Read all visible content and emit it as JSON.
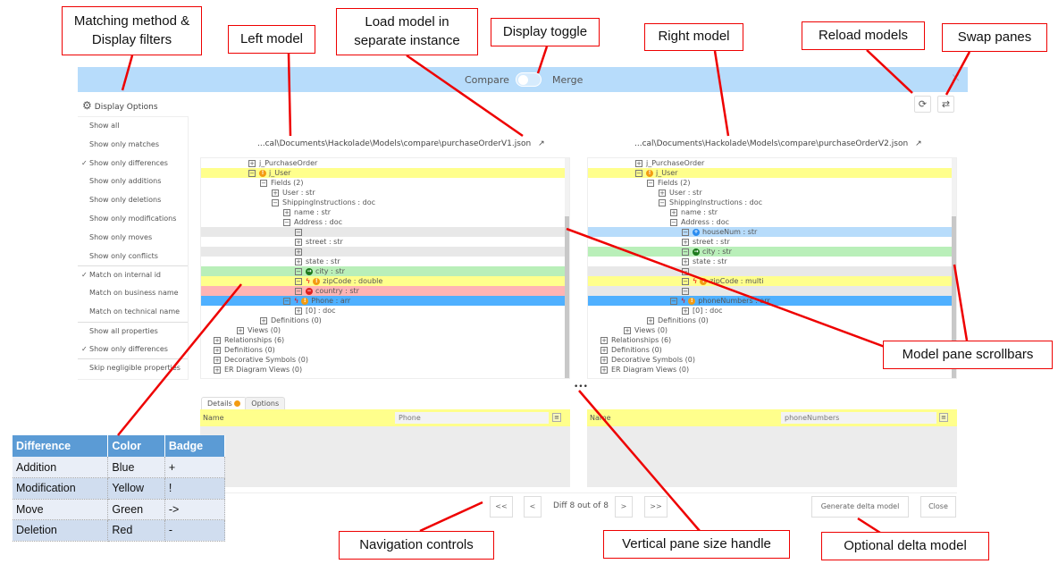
{
  "header": {
    "compare_label": "Compare",
    "merge_label": "Merge",
    "mode": "compare",
    "close_icon": "×"
  },
  "toolbar": {
    "reload_icon": "⟳",
    "swap_icon": "⇄"
  },
  "display_options": {
    "title": "Display Options",
    "items": [
      {
        "label": "Show all",
        "checked": false
      },
      {
        "label": "Show only matches",
        "checked": false
      },
      {
        "label": "Show only differences",
        "checked": true
      },
      {
        "label": "Show only additions",
        "checked": false
      },
      {
        "label": "Show only deletions",
        "checked": false
      },
      {
        "label": "Show only modifications",
        "checked": false
      },
      {
        "label": "Show only moves",
        "checked": false
      },
      {
        "label": "Show only conflicts",
        "checked": false
      },
      {
        "label": "Match on internal id",
        "checked": true,
        "sep": true
      },
      {
        "label": "Match on business name",
        "checked": false
      },
      {
        "label": "Match on technical name",
        "checked": false
      },
      {
        "label": "Show all properties",
        "checked": false,
        "sep": true
      },
      {
        "label": "Show only differences",
        "checked": true
      },
      {
        "label": "Skip negligible properties",
        "checked": false,
        "sep": true
      }
    ]
  },
  "left_model": {
    "path": "...cal\\Documents\\Hackolade\\Models\\compare\\purchaseOrderV1.json",
    "rows": [
      {
        "label": "j_PurchaseOrder",
        "level": 3,
        "box": "+",
        "state": ""
      },
      {
        "label": "j_User",
        "level": 3,
        "box": "-",
        "state": "mod",
        "badges": [
          "mod"
        ]
      },
      {
        "label": "Fields (2)",
        "level": 4,
        "box": "-",
        "state": ""
      },
      {
        "label": "User : str",
        "level": 5,
        "box": "+",
        "state": ""
      },
      {
        "label": "ShippingInstructions : doc",
        "level": 5,
        "box": "-",
        "state": ""
      },
      {
        "label": "name : str",
        "level": 6,
        "box": "+",
        "state": ""
      },
      {
        "label": "Address : doc",
        "level": 6,
        "box": "-",
        "state": ""
      },
      {
        "label": "",
        "level": 7,
        "box": "-",
        "state": "blank"
      },
      {
        "label": "street : str",
        "level": 7,
        "box": "+",
        "state": ""
      },
      {
        "label": "",
        "level": 7,
        "box": "+",
        "state": "blank"
      },
      {
        "label": "state : str",
        "level": 7,
        "box": "+",
        "state": ""
      },
      {
        "label": "city : str",
        "level": 7,
        "box": "-",
        "state": "move",
        "badges": [
          "move"
        ]
      },
      {
        "label": "zipCode : double",
        "level": 7,
        "box": "-",
        "state": "mod",
        "badges": [
          "conflict",
          "mod"
        ]
      },
      {
        "label": "country : str",
        "level": 7,
        "box": "-",
        "state": "del",
        "badges": [
          "del"
        ]
      },
      {
        "label": "Phone : arr",
        "level": 6,
        "box": "-",
        "state": "sel",
        "badges": [
          "conflict",
          "mod"
        ]
      },
      {
        "label": "[0] : doc",
        "level": 7,
        "box": "+",
        "state": ""
      },
      {
        "label": "Definitions (0)",
        "level": 4,
        "box": "+",
        "state": ""
      },
      {
        "label": "Views (0)",
        "level": 2,
        "box": "+",
        "state": ""
      },
      {
        "label": "Relationships (6)",
        "level": 0,
        "box": "+",
        "state": ""
      },
      {
        "label": "Definitions (0)",
        "level": 0,
        "box": "+",
        "state": ""
      },
      {
        "label": "Decorative Symbols (0)",
        "level": 0,
        "box": "+",
        "state": ""
      },
      {
        "label": "ER Diagram Views (0)",
        "level": 0,
        "box": "+",
        "state": ""
      }
    ]
  },
  "right_model": {
    "path": "...cal\\Documents\\Hackolade\\Models\\compare\\purchaseOrderV2.json",
    "rows": [
      {
        "label": "j_PurchaseOrder",
        "level": 3,
        "box": "+",
        "state": ""
      },
      {
        "label": "j_User",
        "level": 3,
        "box": "-",
        "state": "mod",
        "badges": [
          "mod"
        ]
      },
      {
        "label": "Fields (2)",
        "level": 4,
        "box": "-",
        "state": ""
      },
      {
        "label": "User : str",
        "level": 5,
        "box": "+",
        "state": ""
      },
      {
        "label": "ShippingInstructions : doc",
        "level": 5,
        "box": "-",
        "state": ""
      },
      {
        "label": "name : str",
        "level": 6,
        "box": "+",
        "state": ""
      },
      {
        "label": "Address : doc",
        "level": 6,
        "box": "-",
        "state": ""
      },
      {
        "label": "houseNum : str",
        "level": 7,
        "box": "-",
        "state": "add",
        "badges": [
          "add"
        ]
      },
      {
        "label": "street : str",
        "level": 7,
        "box": "+",
        "state": ""
      },
      {
        "label": "city : str",
        "level": 7,
        "box": "-",
        "state": "move",
        "badges": [
          "move"
        ]
      },
      {
        "label": "state : str",
        "level": 7,
        "box": "+",
        "state": ""
      },
      {
        "label": "",
        "level": 7,
        "box": "-",
        "state": "blank"
      },
      {
        "label": "zipCode : multi",
        "level": 7,
        "box": "-",
        "state": "mod",
        "badges": [
          "conflict",
          "mod"
        ]
      },
      {
        "label": "",
        "level": 7,
        "box": "-",
        "state": "blank"
      },
      {
        "label": "phoneNumbers : arr",
        "level": 6,
        "box": "-",
        "state": "sel",
        "badges": [
          "conflict",
          "mod"
        ]
      },
      {
        "label": "[0] : doc",
        "level": 7,
        "box": "+",
        "state": ""
      },
      {
        "label": "Definitions (0)",
        "level": 4,
        "box": "+",
        "state": ""
      },
      {
        "label": "Views (0)",
        "level": 2,
        "box": "+",
        "state": ""
      },
      {
        "label": "Relationships (6)",
        "level": 0,
        "box": "+",
        "state": ""
      },
      {
        "label": "Definitions (0)",
        "level": 0,
        "box": "+",
        "state": ""
      },
      {
        "label": "Decorative Symbols (0)",
        "level": 0,
        "box": "+",
        "state": ""
      },
      {
        "label": "ER Diagram Views (0)",
        "level": 0,
        "box": "+",
        "state": ""
      }
    ]
  },
  "colors": {
    "mod": "#ffff8c",
    "move": "#b9efb9",
    "del": "#ffb4b4",
    "add": "#b7dcfb",
    "sel": "#4fb0ff",
    "blank": "#e8e8e8",
    "badge_mod": "#f39c12",
    "badge_move": "#1e7b1e",
    "badge_del": "#e02020",
    "badge_add": "#2a8cf0"
  },
  "handle_label": "•••",
  "details": {
    "tabs": [
      {
        "label": "Details",
        "badge": true
      },
      {
        "label": "Options"
      }
    ],
    "left": {
      "field": "Name",
      "value": "Phone"
    },
    "right": {
      "field": "Name",
      "value": "phoneNumbers"
    }
  },
  "navigation": {
    "first": "<<",
    "prev": "<",
    "status": "Diff 8 out of 8",
    "next": ">",
    "last": ">>"
  },
  "actions": {
    "generate": "Generate delta model",
    "close": "Close"
  },
  "callouts": {
    "matching": "Matching method & Display filters",
    "left_model": "Left model",
    "load_model": "Load model in separate instance",
    "display_toggle": "Display toggle",
    "right_model": "Right model",
    "reload": "Reload models",
    "swap": "Swap panes",
    "scrollbars": "Model pane scrollbars",
    "navigation": "Navigation controls",
    "handle": "Vertical pane size handle",
    "delta": "Optional delta model"
  },
  "legend": {
    "headers": [
      "Difference",
      "Color",
      "Badge"
    ],
    "rows": [
      [
        "Addition",
        "Blue",
        "+"
      ],
      [
        "Modification",
        "Yellow",
        "!"
      ],
      [
        "Move",
        "Green",
        "->"
      ],
      [
        "Deletion",
        "Red",
        "-"
      ]
    ]
  }
}
